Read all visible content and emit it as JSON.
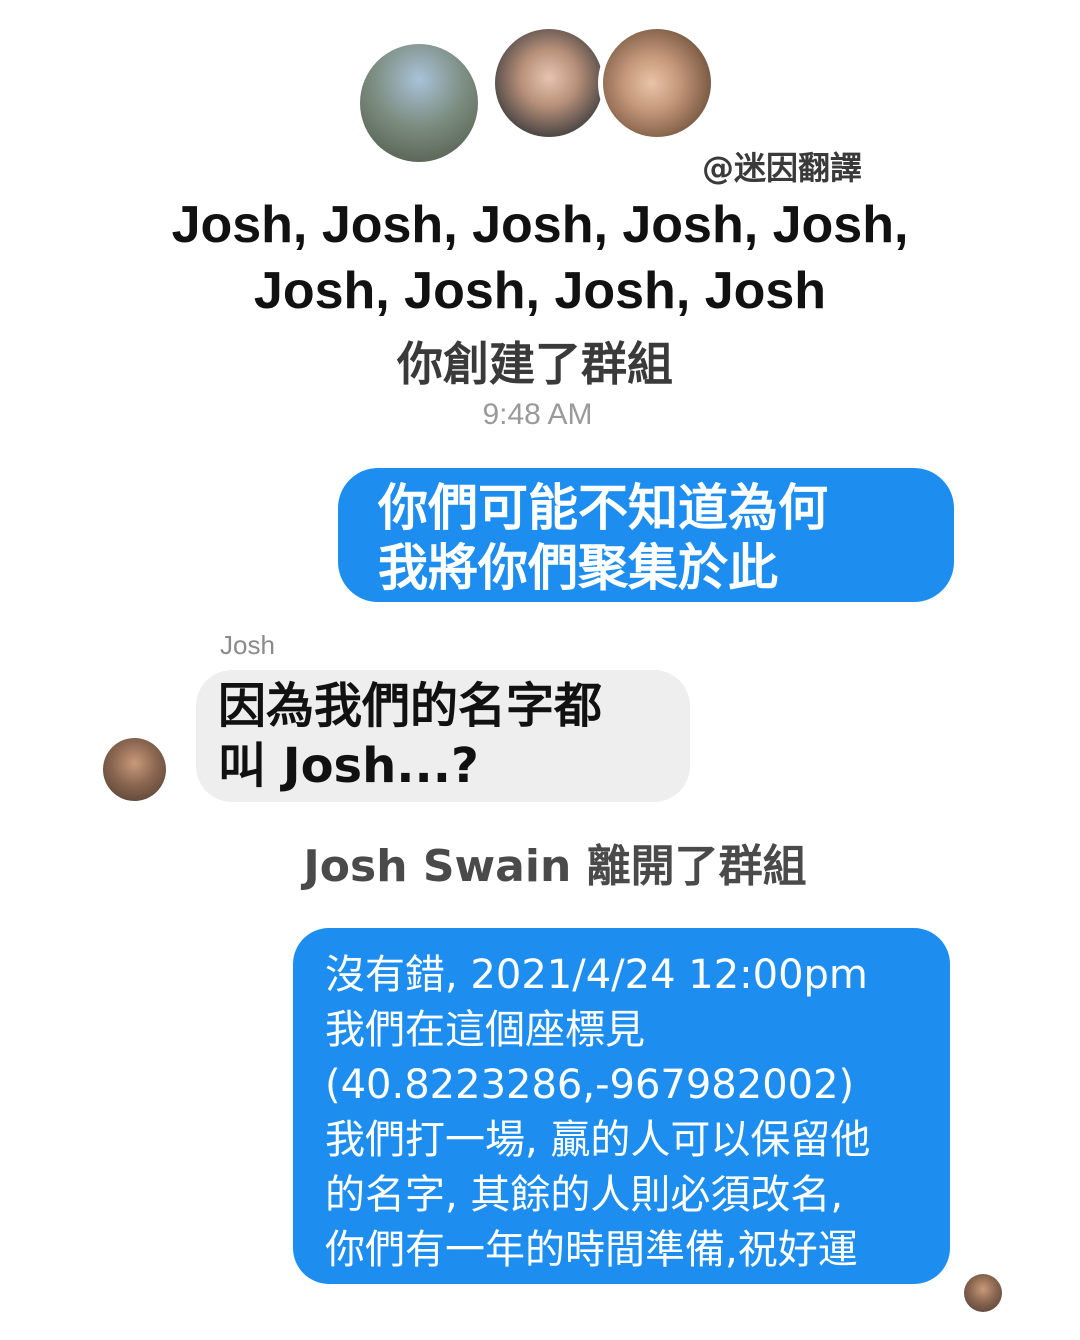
{
  "header": {
    "group_names_line1": "Josh, Josh, Josh, Josh, Josh,",
    "group_names_line2": "Josh, Josh, Josh, Josh",
    "watermark": "@迷因翻譯",
    "created_notice": "你創建了群組",
    "timestamp": "9:48 AM"
  },
  "messages": [
    {
      "side": "outgoing",
      "lines": [
        "你們可能不知道為何",
        "我將你們聚集於此"
      ],
      "color": "#1d8ef0"
    },
    {
      "side": "incoming",
      "sender": "Josh",
      "lines": [
        "因為我們的名字都",
        "叫 Josh...?"
      ],
      "color": "#eeeeee"
    },
    {
      "side": "system",
      "text": "Josh Swain 離開了群組"
    },
    {
      "side": "outgoing",
      "lines": [
        "沒有錯, 2021/4/24 12:00pm",
        "我們在這個座標見",
        "(40.8223286,-967982002)",
        "我們打一場, 贏的人可以保留他",
        "的名字, 其餘的人則必須改名,",
        "你們有一年的時間準備,祝好運"
      ],
      "color": "#1d8ef0"
    }
  ]
}
